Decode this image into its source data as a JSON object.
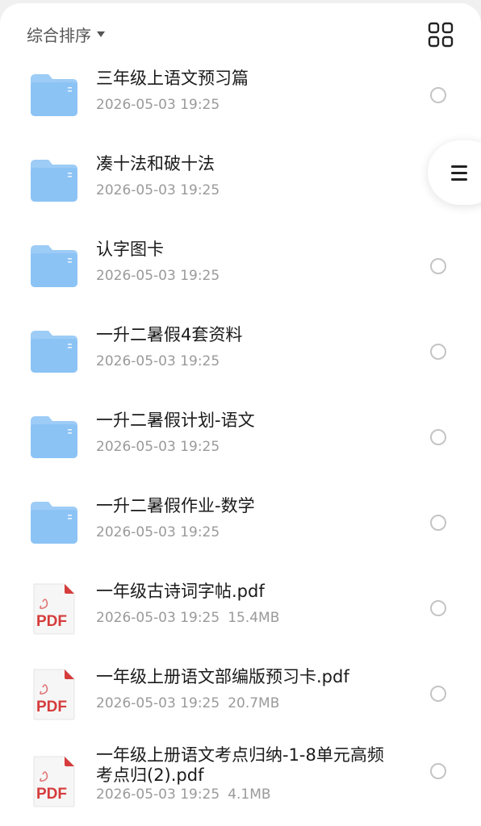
{
  "header": {
    "sort_label": "综合排序"
  },
  "files": [
    {
      "type": "folder",
      "name": "三年级上语文预习篇",
      "date": "2026-05-03 19:25",
      "size": ""
    },
    {
      "type": "folder",
      "name": "凑十法和破十法",
      "date": "2026-05-03 19:25",
      "size": ""
    },
    {
      "type": "folder",
      "name": "认字图卡",
      "date": "2026-05-03 19:25",
      "size": ""
    },
    {
      "type": "folder",
      "name": "一升二暑假4套资料",
      "date": "2026-05-03 19:25",
      "size": ""
    },
    {
      "type": "folder",
      "name": "一升二暑假计划-语文",
      "date": "2026-05-03 19:25",
      "size": ""
    },
    {
      "type": "folder",
      "name": "一升二暑假作业-数学",
      "date": "2026-05-03 19:25",
      "size": ""
    },
    {
      "type": "pdf",
      "name": "一年级古诗词字帖.pdf",
      "date": "2026-05-03 19:25",
      "size": "15.4MB"
    },
    {
      "type": "pdf",
      "name": "一年级上册语文部编版预习卡.pdf",
      "date": "2026-05-03 19:25",
      "size": "20.7MB"
    },
    {
      "type": "pdf",
      "name": "一年级上册语文考点归纳-1-8单元高频考点归(2).pdf",
      "date": "2026-05-03 19:25",
      "size": "4.1MB"
    }
  ],
  "icons": {
    "folder_color": "#8cc3f5",
    "pdf_color": "#d63c3c",
    "pdf_label": "PDF"
  }
}
